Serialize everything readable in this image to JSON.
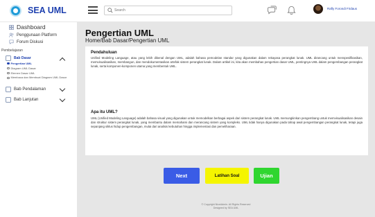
{
  "brand": {
    "name": "SEA UML"
  },
  "search": {
    "placeholder": "Search"
  },
  "user": {
    "name": "Rafly Forondi Firdaus"
  },
  "sidebar": {
    "dashboard": "Dashboard",
    "penggunaan": "Penggunaan Platform",
    "forum": "Forum Diskusi",
    "section_label": "Pembelajaran",
    "bab_dasar": {
      "label": "Bab Dasar",
      "subitems": [
        "Pengertian UML",
        "Diagram UML Dasar",
        "Elemen Dasar UML",
        "Membaca dan Membuat Diagram UML Dasar"
      ]
    },
    "bab_pendalaman": "Bab Pendalaman",
    "bab_lanjutan": "Bab Lanjutan"
  },
  "main": {
    "title": "Pengertian UML",
    "breadcrumb": "Home/Bab Dasar/Pengertian UML",
    "sections": [
      {
        "title": "Pendahuluan",
        "body": "Unified Modeling Language, atau yang lebih dikenal dengan UML, adalah bahasa pemodelan standar yang digunakan dalam rekayasa perangkat lunak. UML dirancang untuk menspesifikasikan, memvisualisasikan, membangun, dan mendokumentasikan artefak sistem perangkat lunak. Dalam artikel ini, kita akan membahas pengertian dasar UML, pentingnya UML dalam pengembangan perangkat lunak, serta komponen-komponen utama yang membentuk UML."
      },
      {
        "title": "Apa itu UML?",
        "body": "UML (Unified Modeling Language) adalah bahasa visual yang digunakan untuk memodelkan berbagai aspek dari sistem perangkat lunak. UML memungkinkan pengembang untuk memvisualisasikan desain dan struktur sistem perangkat lunak, yang membantu dalam memahami dan merancang sistem yang kompleks. UML tidak hanya digunakan pada tahap awal pengembangan perangkat lunak, tetapi juga sepanjang siklus hidup pengembangan, mulai dari analisis kebutuhan hingga implementasi dan pemeliharaan."
      }
    ],
    "buttons": {
      "next": "Next",
      "latihan": "Latihan Soal",
      "ujian": "Ujian"
    },
    "footer": {
      "line1": "© Copyright NiceAdmin. All Rights Reserved",
      "line2": "Designed by SEA UML"
    }
  },
  "colors": {
    "brand": "#1e40af",
    "next": "#3a5ce6",
    "latihan": "#f5f500",
    "ujian": "#2fd62f",
    "content_bg": "#e6e6e6"
  }
}
